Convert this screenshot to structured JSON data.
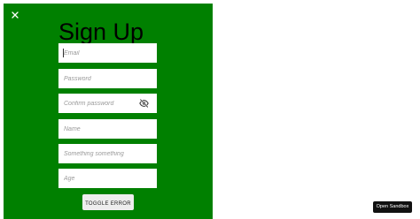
{
  "form": {
    "title": "Sign Up",
    "fields": [
      {
        "name": "email",
        "placeholder": "Email",
        "value": ""
      },
      {
        "name": "password",
        "placeholder": "Password",
        "value": ""
      },
      {
        "name": "confirm_password",
        "placeholder": "Confirm password",
        "value": ""
      },
      {
        "name": "name",
        "placeholder": "Name",
        "value": ""
      },
      {
        "name": "something",
        "placeholder": "Something something",
        "value": ""
      },
      {
        "name": "age",
        "placeholder": "Age",
        "value": ""
      }
    ],
    "toggle_error_label": "TOGGLE ERROR"
  },
  "icons": {
    "close": "close-icon",
    "visibility": "visibility-off-icon"
  },
  "sandbox": {
    "label": "Open Sandbox"
  },
  "colors": {
    "panel_background": "#008000",
    "field_background": "#ffffff",
    "sandbox_button": "#111111"
  }
}
